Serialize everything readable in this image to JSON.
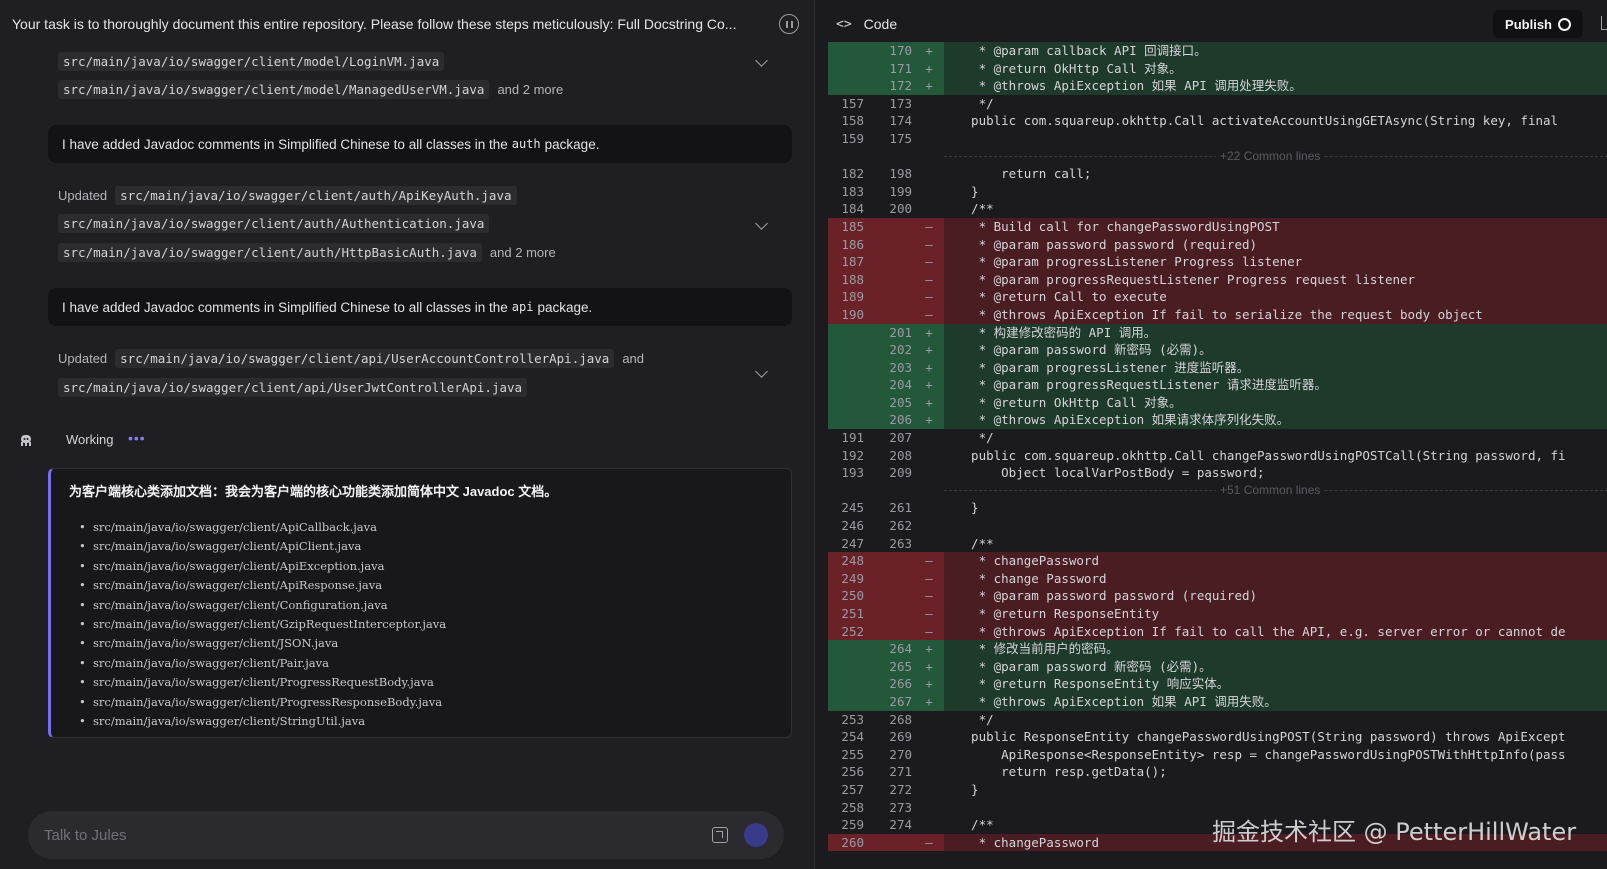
{
  "task": {
    "text": "Your task is to thoroughly document this entire repository. Please follow these steps meticulously: Full Docstring Co..."
  },
  "updates": [
    {
      "label": "",
      "files": [
        "src/main/java/io/swagger/client/model/LoginVM.java",
        "src/main/java/io/swagger/client/model/ManagedUserVM.java"
      ],
      "more": "and 2 more"
    },
    {
      "label": "Updated",
      "files": [
        "src/main/java/io/swagger/client/auth/ApiKeyAuth.java",
        "src/main/java/io/swagger/client/auth/Authentication.java",
        "src/main/java/io/swagger/client/auth/HttpBasicAuth.java"
      ],
      "more": "and 2 more"
    },
    {
      "label": "Updated",
      "files": [
        "src/main/java/io/swagger/client/api/UserAccountControllerApi.java",
        "src/main/java/io/swagger/client/api/UserJwtControllerApi.java"
      ],
      "more": "and"
    }
  ],
  "messages": [
    {
      "pre": "I have added Javadoc comments in Simplified Chinese to all classes in the",
      "code": "auth",
      "post": "package."
    },
    {
      "pre": "I have added Javadoc comments in Simplified Chinese to all classes in the",
      "code": "api",
      "post": "package."
    }
  ],
  "working": {
    "label": "Working",
    "dots": "•••"
  },
  "plan": {
    "title": "为客户端核心类添加文档：我会为客户端的核心功能类添加简体中文 Javadoc 文档。",
    "items": [
      "src/main/java/io/swagger/client/ApiCallback.java",
      "src/main/java/io/swagger/client/ApiClient.java",
      "src/main/java/io/swagger/client/ApiException.java",
      "src/main/java/io/swagger/client/ApiResponse.java",
      "src/main/java/io/swagger/client/Configuration.java",
      "src/main/java/io/swagger/client/GzipRequestInterceptor.java",
      "src/main/java/io/swagger/client/JSON.java",
      "src/main/java/io/swagger/client/Pair.java",
      "src/main/java/io/swagger/client/ProgressRequestBody.java",
      "src/main/java/io/swagger/client/ProgressResponseBody.java",
      "src/main/java/io/swagger/client/StringUtil.java"
    ]
  },
  "chat": {
    "placeholder": "Talk to Jules"
  },
  "code_panel": {
    "icon": "<>",
    "title": "Code",
    "publish_label": "Publish"
  },
  "diff": [
    {
      "t": "add",
      "o": "",
      "n": "170",
      "s": "+",
      "c": "   * @param callback API 回调接口。"
    },
    {
      "t": "add",
      "o": "",
      "n": "171",
      "s": "+",
      "c": "   * @return OkHttp Call 对象。"
    },
    {
      "t": "add",
      "o": "",
      "n": "172",
      "s": "+",
      "c": "   * @throws ApiException 如果 API 调用处理失败。"
    },
    {
      "t": "ctx",
      "o": "157",
      "n": "173",
      "s": "",
      "c": "   */"
    },
    {
      "t": "ctx",
      "o": "158",
      "n": "174",
      "s": "",
      "c": "  public com.squareup.okhttp.Call activateAccountUsingGETAsync(String key, final"
    },
    {
      "t": "ctx",
      "o": "159",
      "n": "175",
      "s": "",
      "c": ""
    },
    {
      "t": "sep",
      "label": "+22 Common lines"
    },
    {
      "t": "ctx",
      "o": "182",
      "n": "198",
      "s": "",
      "c": "      return call;"
    },
    {
      "t": "ctx",
      "o": "183",
      "n": "199",
      "s": "",
      "c": "  }"
    },
    {
      "t": "ctx",
      "o": "184",
      "n": "200",
      "s": "",
      "c": "  /**"
    },
    {
      "t": "del",
      "o": "185",
      "n": "",
      "s": "—",
      "c": "   * Build call for changePasswordUsingPOST"
    },
    {
      "t": "del",
      "o": "186",
      "n": "",
      "s": "—",
      "c": "   * @param password password (required)"
    },
    {
      "t": "del",
      "o": "187",
      "n": "",
      "s": "—",
      "c": "   * @param progressListener Progress listener"
    },
    {
      "t": "del",
      "o": "188",
      "n": "",
      "s": "—",
      "c": "   * @param progressRequestListener Progress request listener"
    },
    {
      "t": "del",
      "o": "189",
      "n": "",
      "s": "—",
      "c": "   * @return Call to execute"
    },
    {
      "t": "del",
      "o": "190",
      "n": "",
      "s": "—",
      "c": "   * @throws ApiException If fail to serialize the request body object"
    },
    {
      "t": "add",
      "o": "",
      "n": "201",
      "s": "+",
      "c": "   * 构建修改密码的 API 调用。"
    },
    {
      "t": "add",
      "o": "",
      "n": "202",
      "s": "+",
      "c": "   * @param password 新密码 (必需)。"
    },
    {
      "t": "add",
      "o": "",
      "n": "203",
      "s": "+",
      "c": "   * @param progressListener 进度监听器。"
    },
    {
      "t": "add",
      "o": "",
      "n": "204",
      "s": "+",
      "c": "   * @param progressRequestListener 请求进度监听器。"
    },
    {
      "t": "add",
      "o": "",
      "n": "205",
      "s": "+",
      "c": "   * @return OkHttp Call 对象。"
    },
    {
      "t": "add",
      "o": "",
      "n": "206",
      "s": "+",
      "c": "   * @throws ApiException 如果请求体序列化失败。"
    },
    {
      "t": "ctx",
      "o": "191",
      "n": "207",
      "s": "",
      "c": "   */"
    },
    {
      "t": "ctx",
      "o": "192",
      "n": "208",
      "s": "",
      "c": "  public com.squareup.okhttp.Call changePasswordUsingPOSTCall(String password, fi"
    },
    {
      "t": "ctx",
      "o": "193",
      "n": "209",
      "s": "",
      "c": "      Object localVarPostBody = password;"
    },
    {
      "t": "sep",
      "label": "+51 Common lines"
    },
    {
      "t": "ctx",
      "o": "245",
      "n": "261",
      "s": "",
      "c": "  }"
    },
    {
      "t": "ctx",
      "o": "246",
      "n": "262",
      "s": "",
      "c": ""
    },
    {
      "t": "ctx",
      "o": "247",
      "n": "263",
      "s": "",
      "c": "  /**"
    },
    {
      "t": "del",
      "o": "248",
      "n": "",
      "s": "—",
      "c": "   * changePassword"
    },
    {
      "t": "del",
      "o": "249",
      "n": "",
      "s": "—",
      "c": "   * change Password"
    },
    {
      "t": "del",
      "o": "250",
      "n": "",
      "s": "—",
      "c": "   * @param password password (required)"
    },
    {
      "t": "del",
      "o": "251",
      "n": "",
      "s": "—",
      "c": "   * @return ResponseEntity"
    },
    {
      "t": "del",
      "o": "252",
      "n": "",
      "s": "—",
      "c": "   * @throws ApiException If fail to call the API, e.g. server error or cannot de"
    },
    {
      "t": "add",
      "o": "",
      "n": "264",
      "s": "+",
      "c": "   * 修改当前用户的密码。"
    },
    {
      "t": "add",
      "o": "",
      "n": "265",
      "s": "+",
      "c": "   * @param password 新密码 (必需)。"
    },
    {
      "t": "add",
      "o": "",
      "n": "266",
      "s": "+",
      "c": "   * @return ResponseEntity 响应实体。"
    },
    {
      "t": "add",
      "o": "",
      "n": "267",
      "s": "+",
      "c": "   * @throws ApiException 如果 API 调用失败。"
    },
    {
      "t": "ctx",
      "o": "253",
      "n": "268",
      "s": "",
      "c": "   */"
    },
    {
      "t": "ctx",
      "o": "254",
      "n": "269",
      "s": "",
      "c": "  public ResponseEntity changePasswordUsingPOST(String password) throws ApiExcept"
    },
    {
      "t": "ctx",
      "o": "255",
      "n": "270",
      "s": "",
      "c": "      ApiResponse<ResponseEntity> resp = changePasswordUsingPOSTWithHttpInfo(pass"
    },
    {
      "t": "ctx",
      "o": "256",
      "n": "271",
      "s": "",
      "c": "      return resp.getData();"
    },
    {
      "t": "ctx",
      "o": "257",
      "n": "272",
      "s": "",
      "c": "  }"
    },
    {
      "t": "ctx",
      "o": "258",
      "n": "273",
      "s": "",
      "c": ""
    },
    {
      "t": "ctx",
      "o": "259",
      "n": "274",
      "s": "",
      "c": "  /**"
    },
    {
      "t": "del",
      "o": "260",
      "n": "",
      "s": "—",
      "c": "   * changePassword"
    }
  ],
  "watermark": "掘金技术社区 @ PetterHillWater"
}
